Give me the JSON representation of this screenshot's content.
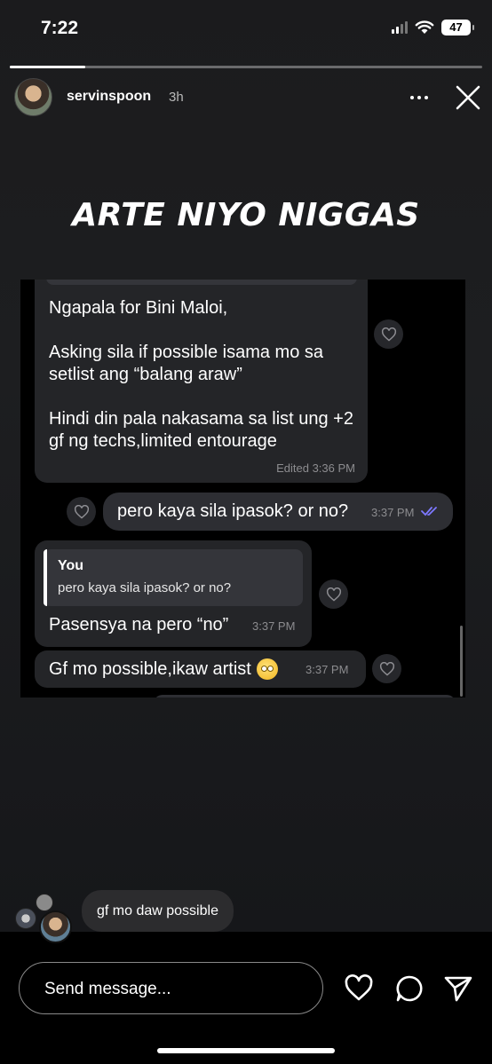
{
  "status_bar": {
    "time": "7:22",
    "battery": "47"
  },
  "story": {
    "progress_fraction": 0.16,
    "username": "servinspoon",
    "time_ago": "3h",
    "overlay_text": "ARTE NIYO NIGGAS"
  },
  "chat": {
    "messages": [
      {
        "text": "Ngapala for Bini Maloi,\n\nAsking sila if possible isama mo sa setlist ang “balang araw”\n\nHindi din pala nakasama sa list ung +2 gf ng techs,limited entourage",
        "meta": "Edited  3:36 PM"
      },
      {
        "text": "pero kaya sila ipasok? or no?",
        "meta": "3:37 PM"
      },
      {
        "reply_name": "You",
        "reply_text": "pero kaya sila ipasok? or no?",
        "text": "Pasensya na pero “no”",
        "meta": "3:37 PM"
      },
      {
        "text": "Gf mo possible,ikaw artist",
        "meta": "3:37 PM"
      }
    ]
  },
  "viewer_reply": {
    "text": "gf mo daw possible"
  },
  "composer": {
    "placeholder": "Send message..."
  },
  "icons": [
    "more-icon",
    "close-icon",
    "heart-icon",
    "double-check-icon",
    "smiley-icon",
    "messages-icon",
    "send-icon"
  ]
}
